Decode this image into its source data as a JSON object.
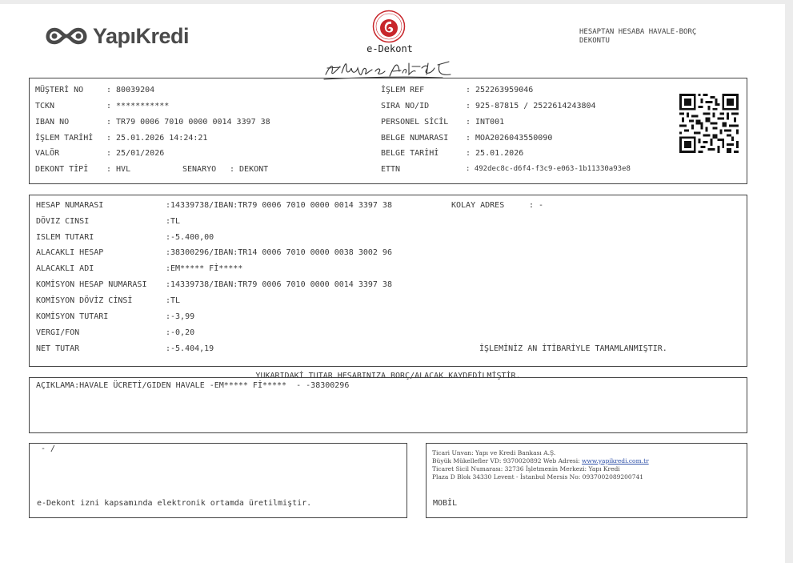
{
  "header": {
    "brand": "YapıKredi",
    "title": "e-Dekont",
    "doc_type": [
      "HESAPTAN HESABA HAVALE-BORÇ",
      "DEKONTU"
    ]
  },
  "info_left": [
    {
      "label": "MÜŞTERİ NO",
      "value": ": 80039204"
    },
    {
      "label": "TCKN",
      "value": ": ***********"
    },
    {
      "label": "IBAN NO",
      "value": ": TR79 0006 7010 0000 0014 3397 38"
    },
    {
      "label": "İŞLEM TARİHİ",
      "value": ": 25.01.2026 14:24:21"
    },
    {
      "label": "VALÖR",
      "value": ": 25/01/2026"
    },
    {
      "label": "DEKONT TİPİ",
      "value": ": HVL"
    }
  ],
  "scenario": {
    "label": "SENARYO",
    "value": ": DEKONT"
  },
  "info_right": [
    {
      "label": "İŞLEM REF",
      "value": ": 252263959046"
    },
    {
      "label": "SIRA NO/ID",
      "value": ": 925-87815 / 2522614243804"
    },
    {
      "label": "PERSONEL SİCİL",
      "value": ": INT001"
    },
    {
      "label": "BELGE NUMARASI",
      "value": ": MOA2026043550090"
    },
    {
      "label": "BELGE TARİHİ",
      "value": ": 25.01.2026"
    },
    {
      "label": "ETTN",
      "value": ": 492dec8c-d6f4-f3c9-e063-1b11330a93e8"
    }
  ],
  "details": [
    {
      "label": "HESAP NUMARASI",
      "value": ":14339738/IBAN:TR79 0006 7010 0000 0014 3397 38"
    },
    {
      "label": "DÖVIZ CINSI",
      "value": ":TL"
    },
    {
      "label": "ISLEM TUTARI",
      "value": ":-5.400,00"
    },
    {
      "label": "ALACAKLI HESAP",
      "value": ":38300296/IBAN:TR14 0006 7010 0000 0038 3002 96"
    },
    {
      "label": "ALACAKLI ADI",
      "value": ":EM***** Fİ*****"
    },
    {
      "label": "KOMİSYON HESAP NUMARASI",
      "value": ":14339738/IBAN:TR79 0006 7010 0000 0014 3397 38"
    },
    {
      "label": "KOMİSYON DÖVİZ CİNSİ",
      "value": ":TL"
    },
    {
      "label": "KOMİSYON TUTARI",
      "value": ":-3,99"
    },
    {
      "label": "VERGI/FON",
      "value": ":-0,20"
    },
    {
      "label": "NET TUTAR",
      "value": ":-5.404,19"
    }
  ],
  "kolay_adres": {
    "label": "KOLAY ADRES",
    "value": ": -"
  },
  "status_note": "İŞLEMİNİZ AN İTİBARİYLE TAMAMLANMIŞTIR.",
  "center_note": "YUKARIDAKİ TUTAR HESABINIZA BORÇ/ALACAK KAYDEDİLMİŞTİR.",
  "description": "AÇIKLAMA:HAVALE ÜCRETİ/GIDEN HAVALE -EM***** Fİ*****  - -38300296",
  "footer_left": {
    "top": " - /",
    "bottom": "e-Dekont izni kapsamında elektronik ortamda üretilmiştir."
  },
  "footer_right": {
    "line1": "Ticari Unvan: Yapı ve Kredi Bankası A.Ş.",
    "line2_prefix": "Büyük Mükellefler VD: 9370020892 Web Adresi: ",
    "line2_link": "www.yapikredi.com.tr",
    "line3": "Ticaret Sicil Numarası: 32736 İşletmenin Merkezi: Yapı Kredi",
    "line4": "Plaza D Blok 34330 Levent - İstanbul Mersis No: 0937002089200741",
    "channel": "MOBİL"
  },
  "colors": {
    "border": "#444444",
    "text": "#3a3a3a",
    "link": "#2d4fa8",
    "seal_red": "#c8262b"
  }
}
